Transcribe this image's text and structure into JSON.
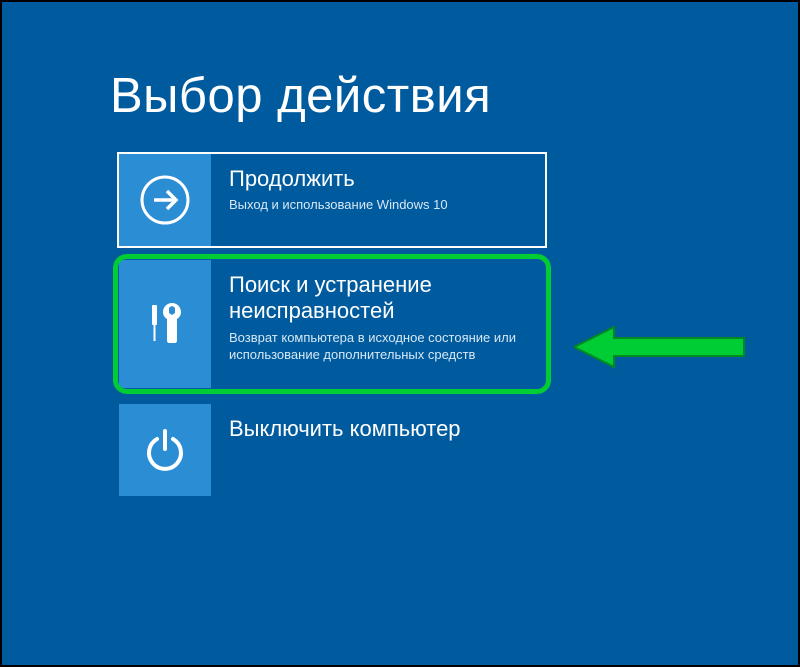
{
  "screen": {
    "title": "Выбор действия"
  },
  "options": [
    {
      "id": "continue",
      "title": "Продолжить",
      "desc": "Выход и использование Windows 10"
    },
    {
      "id": "troubleshoot",
      "title": "Поиск и устранение неисправностей",
      "desc": "Возврат компьютера в исходное состояние или использование дополнительных средств"
    },
    {
      "id": "shutdown",
      "title": "Выключить компьютер",
      "desc": ""
    }
  ],
  "colors": {
    "background": "#005a9e",
    "tile": "#2b8dd4",
    "highlight": "#00cc33"
  }
}
